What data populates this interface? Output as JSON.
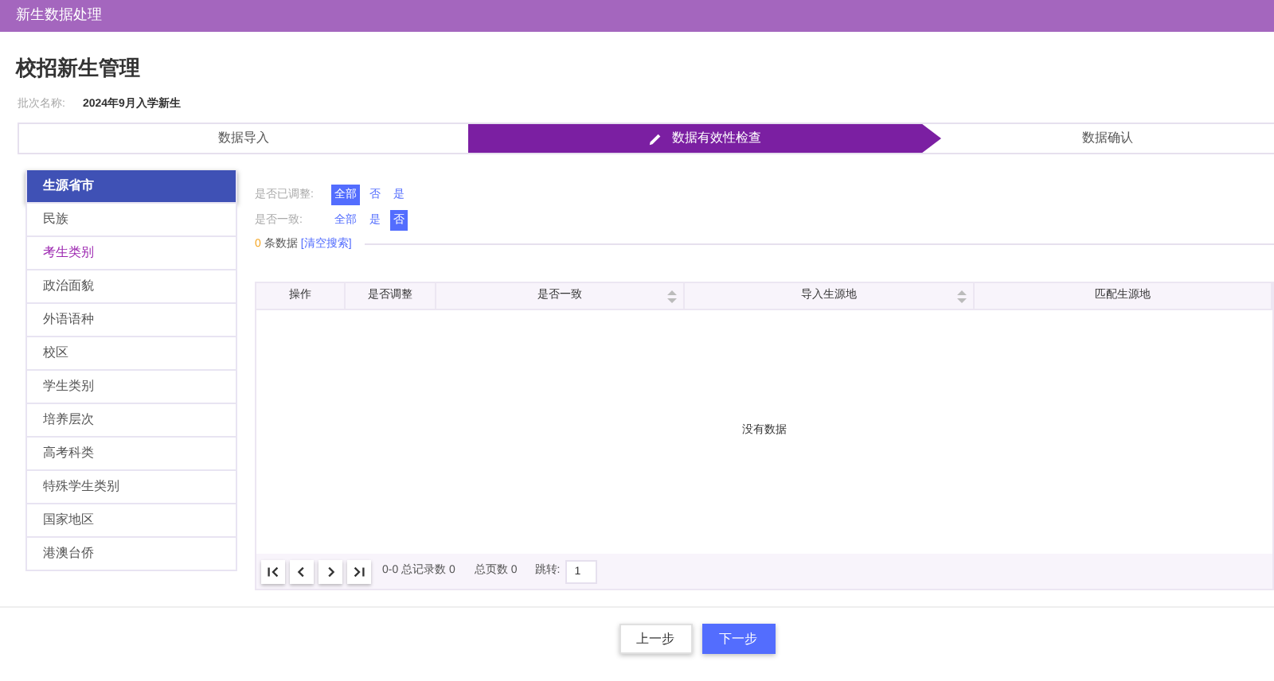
{
  "header": {
    "title": "新生数据处理"
  },
  "page_title": "校招新生管理",
  "batch": {
    "label": "批次名称:",
    "value": "2024年9月入学新生"
  },
  "steps": [
    {
      "label": "数据导入",
      "selected": false
    },
    {
      "label": "数据有效性检查",
      "selected": true
    },
    {
      "label": "数据确认",
      "selected": false
    }
  ],
  "sidebar": {
    "items": [
      {
        "label": "生源省市",
        "selected": true,
        "highlighted": false
      },
      {
        "label": "民族",
        "selected": false,
        "highlighted": false
      },
      {
        "label": "考生类别",
        "selected": false,
        "highlighted": true
      },
      {
        "label": "政治面貌",
        "selected": false,
        "highlighted": false
      },
      {
        "label": "外语语种",
        "selected": false,
        "highlighted": false
      },
      {
        "label": "校区",
        "selected": false,
        "highlighted": false
      },
      {
        "label": "学生类别",
        "selected": false,
        "highlighted": false
      },
      {
        "label": "培养层次",
        "selected": false,
        "highlighted": false
      },
      {
        "label": "高考科类",
        "selected": false,
        "highlighted": false
      },
      {
        "label": "特殊学生类别",
        "selected": false,
        "highlighted": false
      },
      {
        "label": "国家地区",
        "selected": false,
        "highlighted": false
      },
      {
        "label": "港澳台侨",
        "selected": false,
        "highlighted": false
      }
    ]
  },
  "filters": [
    {
      "label": "是否已调整:",
      "options": [
        {
          "label": "全部",
          "selected": true
        },
        {
          "label": "否",
          "selected": false
        },
        {
          "label": "是",
          "selected": false
        }
      ]
    },
    {
      "label": "是否一致:",
      "options": [
        {
          "label": "全部",
          "selected": false
        },
        {
          "label": "是",
          "selected": false
        },
        {
          "label": "否",
          "selected": true
        }
      ]
    }
  ],
  "result": {
    "count": "0",
    "unit": "条数据",
    "clear_link": "[清空搜索]"
  },
  "table": {
    "columns": [
      {
        "label": "操作",
        "sortable": false
      },
      {
        "label": "是否调整",
        "sortable": false
      },
      {
        "label": "是否一致",
        "sortable": true
      },
      {
        "label": "导入生源地",
        "sortable": true
      },
      {
        "label": "匹配生源地",
        "sortable": false
      }
    ],
    "empty_text": "没有数据"
  },
  "pagination": {
    "range": "0-0 总记录数 0",
    "pages": "总页数 0",
    "jump_label": "跳转:",
    "jump_value": "1"
  },
  "buttons": [
    {
      "label": "上一步",
      "kind": "secondary"
    },
    {
      "label": "下一步",
      "kind": "primary"
    }
  ]
}
